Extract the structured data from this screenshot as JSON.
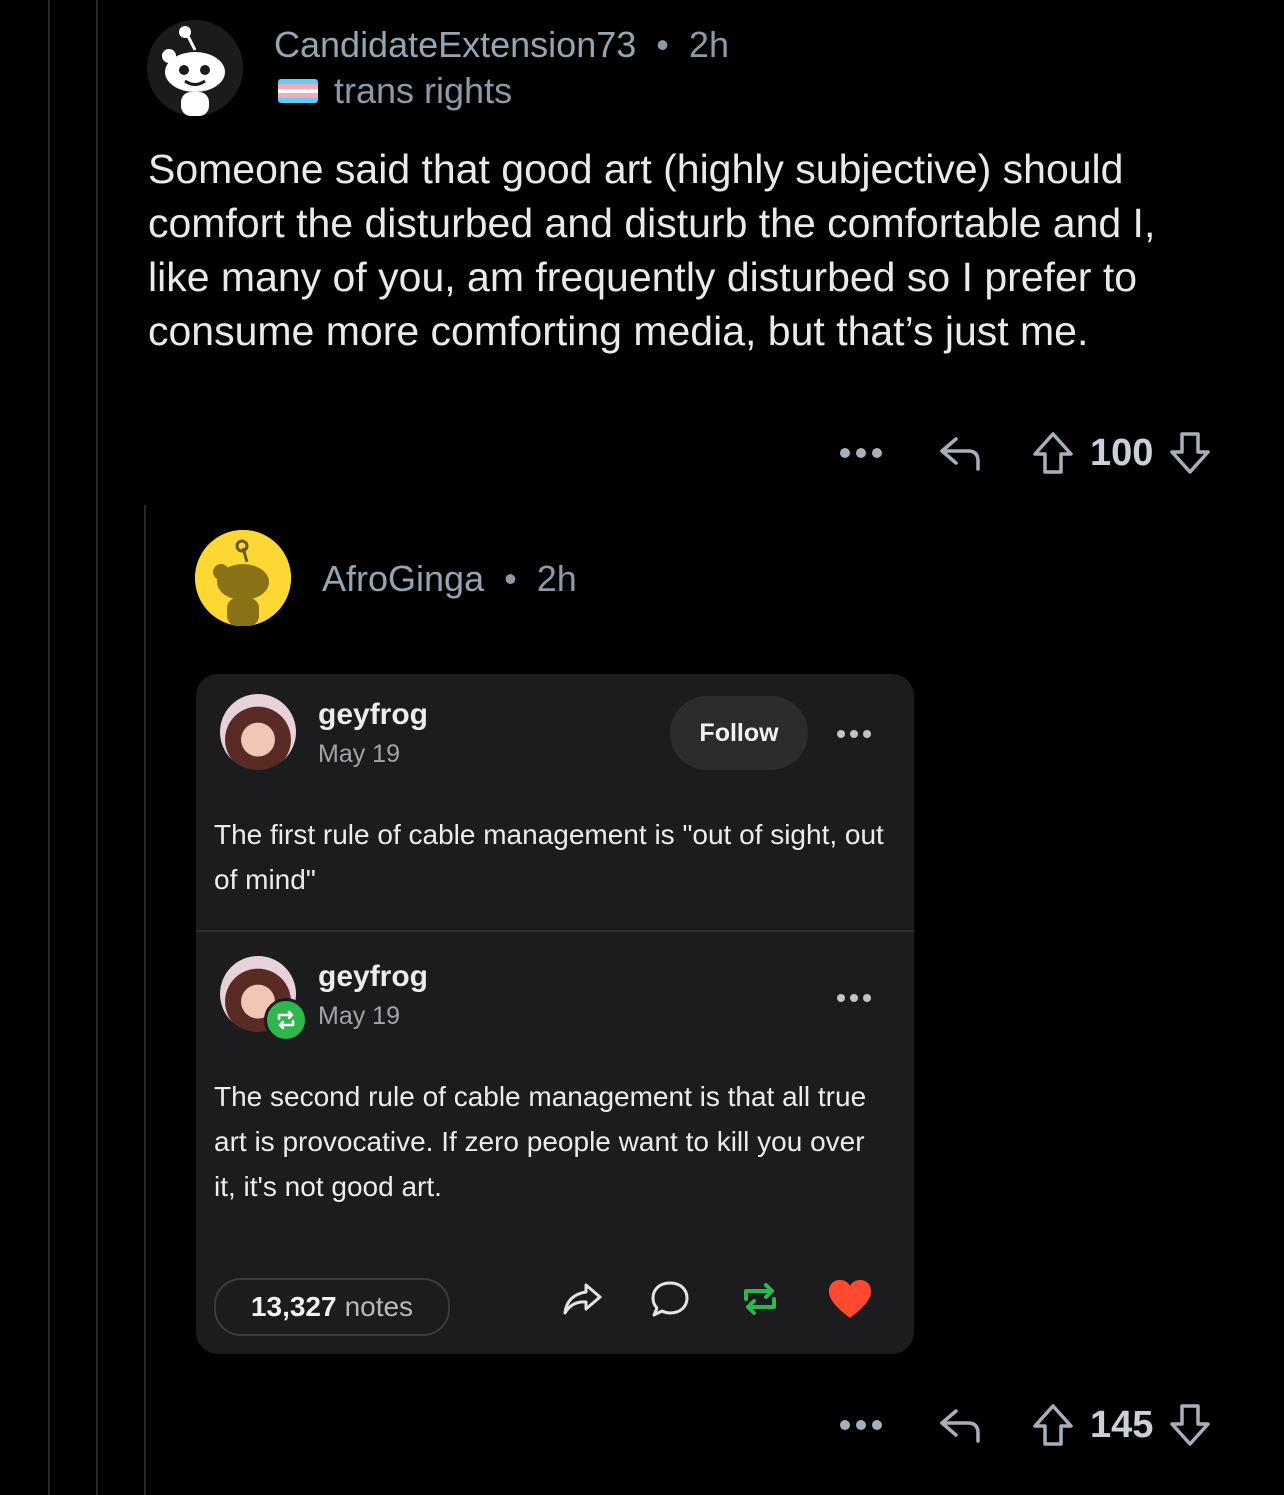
{
  "comment1": {
    "username": "CandidateExtension73",
    "separator": "•",
    "time": "2h",
    "flair": "trans rights",
    "body": "Someone said that good art (highly subjective) should comfort the disturbed and disturb the comfortable and I, like many of you, am frequently disturbed so I prefer to consume more comforting media, but that’s just me.",
    "score": "100"
  },
  "comment2": {
    "username": "AfroGinga",
    "separator": "•",
    "time": "2h",
    "score": "145",
    "embed": {
      "post1": {
        "author": "geyfrog",
        "date": "May 19",
        "follow_label": "Follow",
        "text": "The first rule of cable management is \"out of sight, out of mind\""
      },
      "post2": {
        "author": "geyfrog",
        "date": "May 19",
        "text": "The second rule of cable management is that all true art is provocative. If zero people want to kill you over it, it's not good art."
      },
      "notes_count": "13,327",
      "notes_label": "notes"
    }
  },
  "colors": {
    "background": "#000000",
    "card": "#1c1c1e",
    "reblog_green": "#2fb64d",
    "like_red": "#ff4930",
    "avatar_yellow": "#fdd835"
  },
  "icons": [
    "reddit-snoo-avatar",
    "more-icon",
    "reply-icon",
    "upvote-icon",
    "downvote-icon",
    "share-icon",
    "comment-icon",
    "reblog-icon",
    "heart-icon"
  ]
}
